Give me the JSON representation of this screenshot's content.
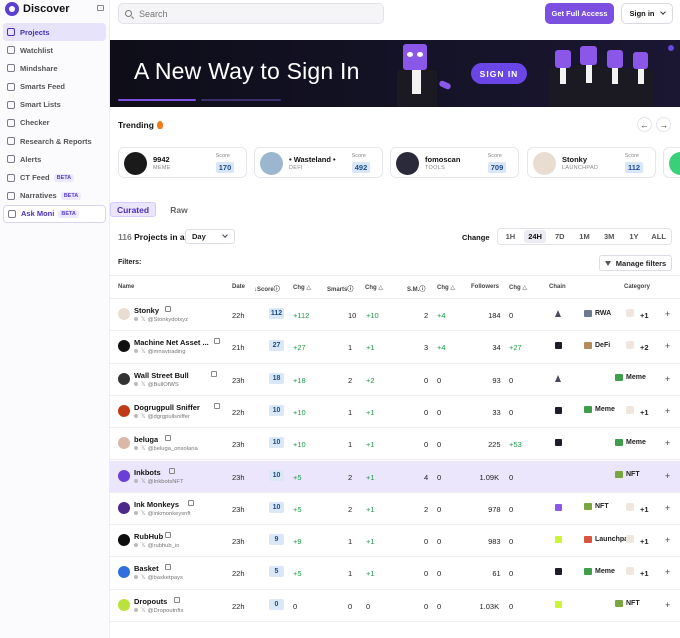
{
  "app": {
    "name": "Discover"
  },
  "sidebar": {
    "items": [
      {
        "label": "Projects",
        "active": true
      },
      {
        "label": "Watchlist"
      },
      {
        "label": "Mindshare"
      },
      {
        "label": "Smarts Feed"
      },
      {
        "label": "Smart Lists"
      },
      {
        "label": "Checker"
      },
      {
        "label": "Research & Reports"
      },
      {
        "label": "Alerts"
      },
      {
        "label": "CT Feed",
        "badge": "BETA"
      },
      {
        "label": "Narratives",
        "badge": "BETA"
      },
      {
        "label": "Ask Moni",
        "badge": "BETA"
      }
    ]
  },
  "topbar": {
    "search_placeholder": "Search",
    "full_access_label": "Get Full Access",
    "sign_in_label": "Sign in"
  },
  "banner": {
    "title": "A New Way to Sign In",
    "button_label": "SIGN IN"
  },
  "trending": {
    "title": "Trending",
    "score_label": "Score",
    "cards": [
      {
        "name": "9942",
        "category": "MEME",
        "score": "170",
        "avatar_color": "#1a1a1a"
      },
      {
        "name": "• Wasteland •",
        "category": "DEFI",
        "score": "492",
        "avatar_color": "#9bb7cf"
      },
      {
        "name": "fomoscan",
        "category": "TOOLS",
        "score": "709",
        "avatar_color": "#2a2a3a"
      },
      {
        "name": "Stonky",
        "category": "LAUNCHPAD",
        "score": "112",
        "avatar_color": "#e8ddd0"
      }
    ]
  },
  "tabs": {
    "curated": "Curated",
    "raw": "Raw"
  },
  "projects_count": {
    "number": "116",
    "text": "Projects in a",
    "period": "Day"
  },
  "change": {
    "label": "Change",
    "ranges": [
      "1H",
      "24H",
      "7D",
      "1M",
      "3M",
      "1Y",
      "ALL"
    ],
    "active": "24H"
  },
  "filters": {
    "label": "Filters:",
    "manage_label": "Manage filters"
  },
  "table": {
    "headers": {
      "name": "Name",
      "date": "Date",
      "score": "Score",
      "chg1": "Chg",
      "smarts": "Smarts",
      "chg2": "Chg",
      "sm": "S.M.",
      "chg3": "Chg",
      "followers": "Followers",
      "chg4": "Chg",
      "chain": "Chain",
      "category": "Category"
    },
    "rows": [
      {
        "name": "Stonky",
        "handle": "@Stonkydotxyz",
        "date": "22h",
        "score": "112",
        "chg1": "+112",
        "smarts": "10",
        "chg2": "+10",
        "sm": "2",
        "chg3": "+4",
        "followers": "184",
        "chg4": "0",
        "chain": "eth",
        "category": "RWA",
        "more": "+1",
        "avatar_color": "#e8ddd0",
        "highlight": false
      },
      {
        "name": "Machine Net Asset ...",
        "handle": "@mnavtrading",
        "date": "21h",
        "score": "27",
        "chg1": "+27",
        "smarts": "1",
        "chg2": "+1",
        "sm": "3",
        "chg3": "+4",
        "followers": "34",
        "chg4": "+27",
        "chain": "dark",
        "category": "DeFi",
        "more": "+2",
        "avatar_color": "#111111",
        "highlight": false
      },
      {
        "name": "Wall Street Bull",
        "handle": "@BullOfWS",
        "date": "23h",
        "score": "18",
        "chg1": "+18",
        "smarts": "2",
        "chg2": "+2",
        "sm": "0",
        "chg3": "0",
        "followers": "93",
        "chg4": "0",
        "chain": "eth",
        "category": "Meme",
        "more": "",
        "avatar_color": "#333333",
        "highlight": false
      },
      {
        "name": "Dogrugpull Sniffer",
        "handle": "@dgrgpullsniffer",
        "date": "22h",
        "score": "10",
        "chg1": "+10",
        "smarts": "1",
        "chg2": "+1",
        "sm": "0",
        "chg3": "0",
        "followers": "33",
        "chg4": "0",
        "chain": "dark",
        "category": "Meme",
        "more": "+1",
        "avatar_color": "#c0391b",
        "highlight": false
      },
      {
        "name": "beluga",
        "handle": "@beluga_onsolana",
        "date": "23h",
        "score": "10",
        "chg1": "+10",
        "smarts": "1",
        "chg2": "+1",
        "sm": "0",
        "chg3": "0",
        "followers": "225",
        "chg4": "+53",
        "chain": "dark",
        "category": "Meme",
        "more": "",
        "avatar_color": "#d9b8a8",
        "highlight": false
      },
      {
        "name": "Inkbots",
        "handle": "@InkbotsNFT",
        "date": "23h",
        "score": "10",
        "chg1": "+5",
        "smarts": "2",
        "chg2": "+1",
        "sm": "4",
        "chg3": "0",
        "followers": "1.09K",
        "chg4": "0",
        "chain": "",
        "category": "NFT",
        "more": "",
        "avatar_color": "#6a3fd6",
        "highlight": true
      },
      {
        "name": "Ink Monkeys",
        "handle": "@inkmonkeysnft",
        "date": "23h",
        "score": "10",
        "chg1": "+5",
        "smarts": "2",
        "chg2": "+1",
        "sm": "2",
        "chg3": "0",
        "followers": "978",
        "chg4": "0",
        "chain": "purple",
        "category": "NFT",
        "more": "+1",
        "avatar_color": "#4b2a8a",
        "highlight": false
      },
      {
        "name": "RubHub",
        "handle": "@rubhub_io",
        "date": "23h",
        "score": "9",
        "chg1": "+9",
        "smarts": "1",
        "chg2": "+1",
        "sm": "0",
        "chg3": "0",
        "followers": "983",
        "chg4": "0",
        "chain": "sol",
        "category": "Launchpad",
        "more": "+1",
        "avatar_color": "#0d0d0d",
        "highlight": false
      },
      {
        "name": "Basket",
        "handle": "@basketpays",
        "date": "22h",
        "score": "5",
        "chg1": "+5",
        "smarts": "1",
        "chg2": "+1",
        "sm": "0",
        "chg3": "0",
        "followers": "61",
        "chg4": "0",
        "chain": "dark",
        "category": "Meme",
        "more": "+1",
        "avatar_color": "#2f6fe0",
        "highlight": false
      },
      {
        "name": "Dropouts",
        "handle": "@Dropoutnfts",
        "date": "22h",
        "score": "0",
        "chg1": "0",
        "smarts": "0",
        "chg2": "0",
        "sm": "0",
        "chg3": "0",
        "followers": "1.03K",
        "chg4": "0",
        "chain": "sol",
        "category": "NFT",
        "more": "",
        "avatar_color": "#b9e23a",
        "highlight": false
      }
    ]
  },
  "colors": {
    "accent": "#7b4fe0",
    "positive": "#1f9a4a",
    "score_bg": "#d9e7f6"
  }
}
